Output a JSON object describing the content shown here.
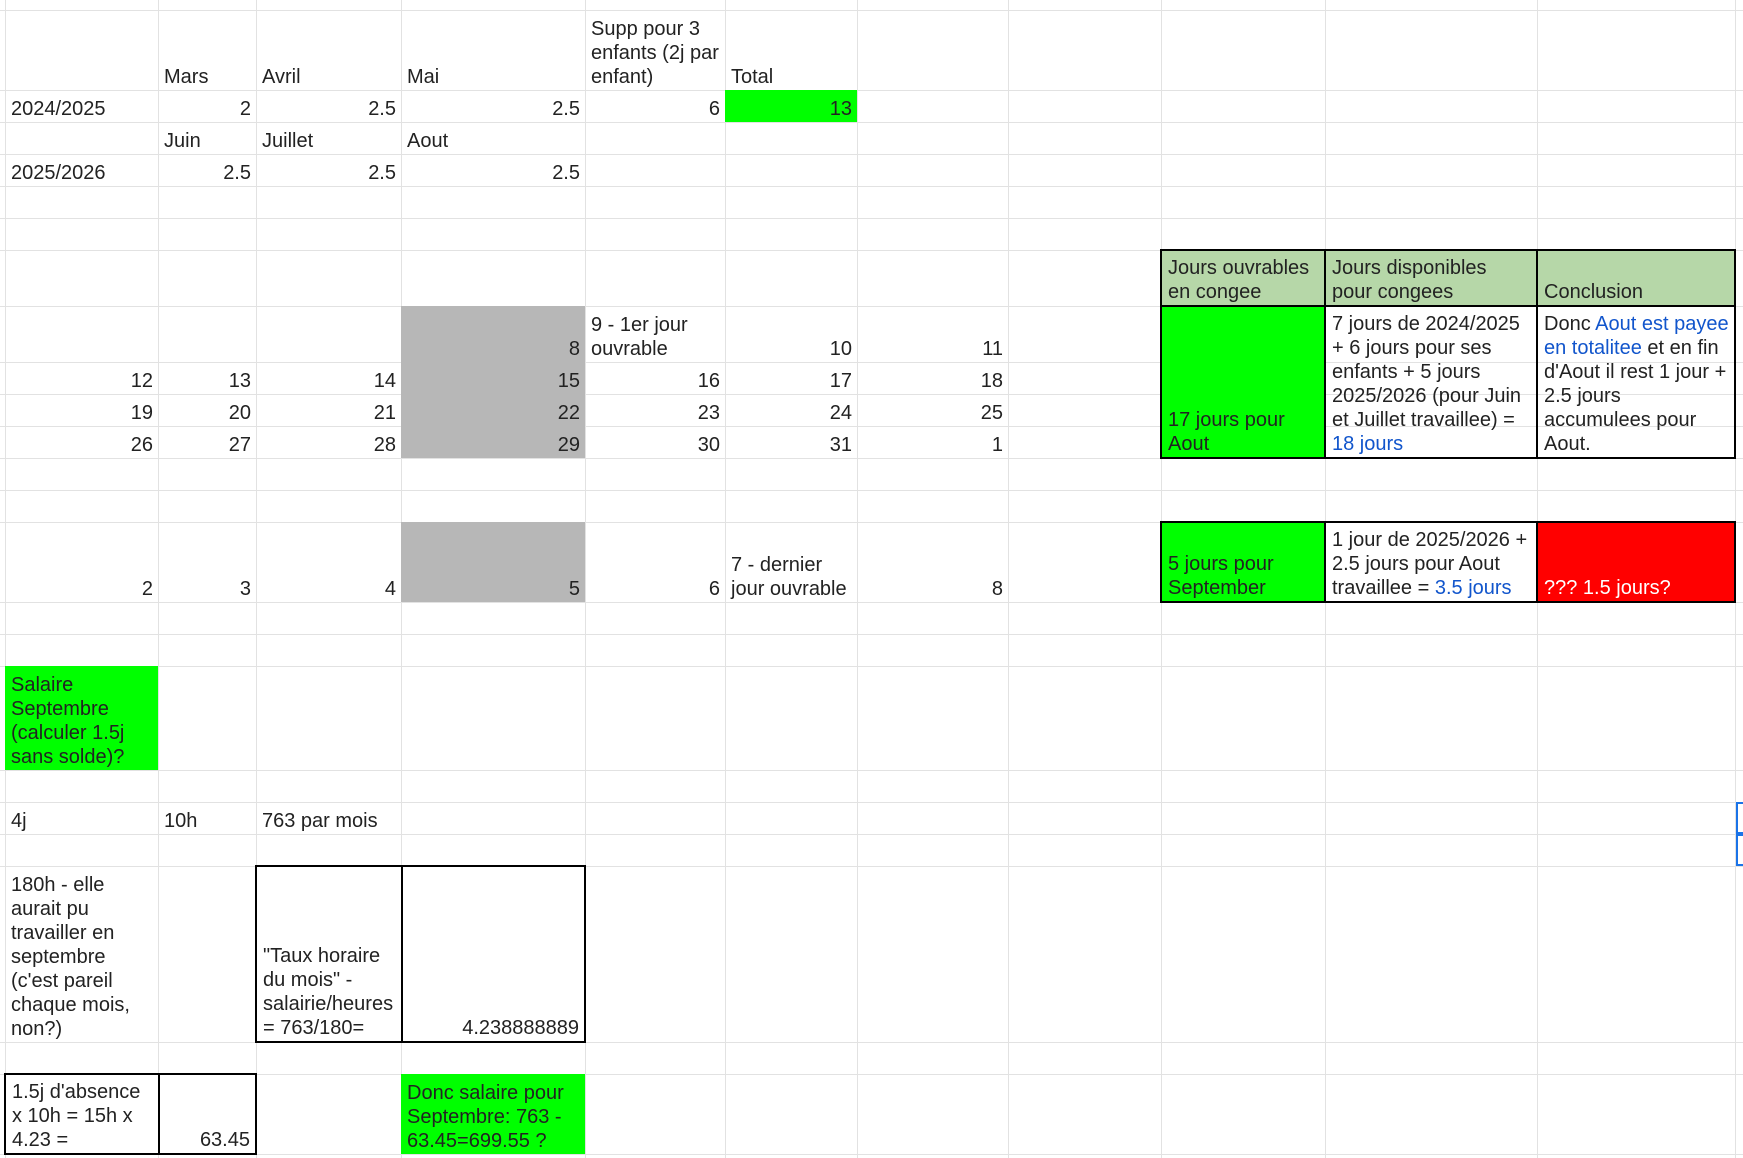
{
  "header": {
    "mars": "Mars",
    "avril": "Avril",
    "mai": "Mai",
    "supp": "Supp pour 3 enfants (2j par enfant)",
    "total": "Total",
    "juin": "Juin",
    "juillet": "Juillet",
    "aout": "Aout"
  },
  "rows": {
    "y2024_label": "2024/2025",
    "y2024_mars": "2",
    "y2024_avril": "2.5",
    "y2024_mai": "2.5",
    "y2024_supp": "6",
    "y2024_total": "13",
    "y2025_label": "2025/2026",
    "y2025_juin": "2.5",
    "y2025_juillet": "2.5",
    "y2025_aout": "2.5"
  },
  "calendar": {
    "c8": "8",
    "c9": "9 - 1er jour ouvrable",
    "c10": "10",
    "c11": "11",
    "c12": "12",
    "c13": "13",
    "c14": "14",
    "c15": "15",
    "c16": "16",
    "c17": "17",
    "c18": "18",
    "c19": "19",
    "c20": "20",
    "c21": "21",
    "c22": "22",
    "c23": "23",
    "c24": "24",
    "c25": "25",
    "c26": "26",
    "c27": "27",
    "c28": "28",
    "c29": "29",
    "c30": "30",
    "c31": "31",
    "c1": "1",
    "s2": "2",
    "s3": "3",
    "s4": "4",
    "s5": "5",
    "s6": "6",
    "s7": "7 - dernier jour ouvrable",
    "s8": "8"
  },
  "summary": {
    "h1": "Jours ouvrables en congee",
    "h2": "Jours disponibles pour congees",
    "h3": "Conclusion",
    "aout_days": "17 jours pour Aout",
    "aout_avail_text": "7 jours de 2024/2025 + 6 jours pour ses enfants + 5 jours 2025/2026 (pour Juin et Juillet travaillee) = ",
    "aout_avail_link": "18 jours",
    "concl_pre": "Donc ",
    "concl_link": "Aout est payee en totalitee",
    "concl_post": " et en fin d'Aout il rest 1 jour + 2.5 jours accumulees pour Aout.",
    "sept_days": "5 jours pour September",
    "sept_avail_text": "1 jour de 2025/2026 + 2.5 jours pour Aout travaillee = ",
    "sept_avail_link": "3.5 jours",
    "sept_concl": "??? 1.5 jours?"
  },
  "salary": {
    "title": "Salaire Septembre (calculer 1.5j sans solde)?",
    "days": "4j",
    "hours": "10h",
    "monthly": "763 par mois",
    "hours_note": "180h - elle aurait pu travailler en septembre (c'est pareil chaque mois, non?)",
    "rate_label": "\"Taux horaire du mois\" - salairie/heures = 763/180=",
    "rate_value": "4.238888889",
    "absence_label": "1.5j d'absence x 10h = 15h x 4.23 =",
    "absence_value": "63.45",
    "final": "Donc salaire pour Septembre: 763 - 63.45=699.55 ?"
  },
  "colors": {
    "green": "#00ff00",
    "gray": "#b7b7b7",
    "light_green": "#b6d7a8",
    "red": "#ff0000",
    "link": "#1155cc"
  }
}
